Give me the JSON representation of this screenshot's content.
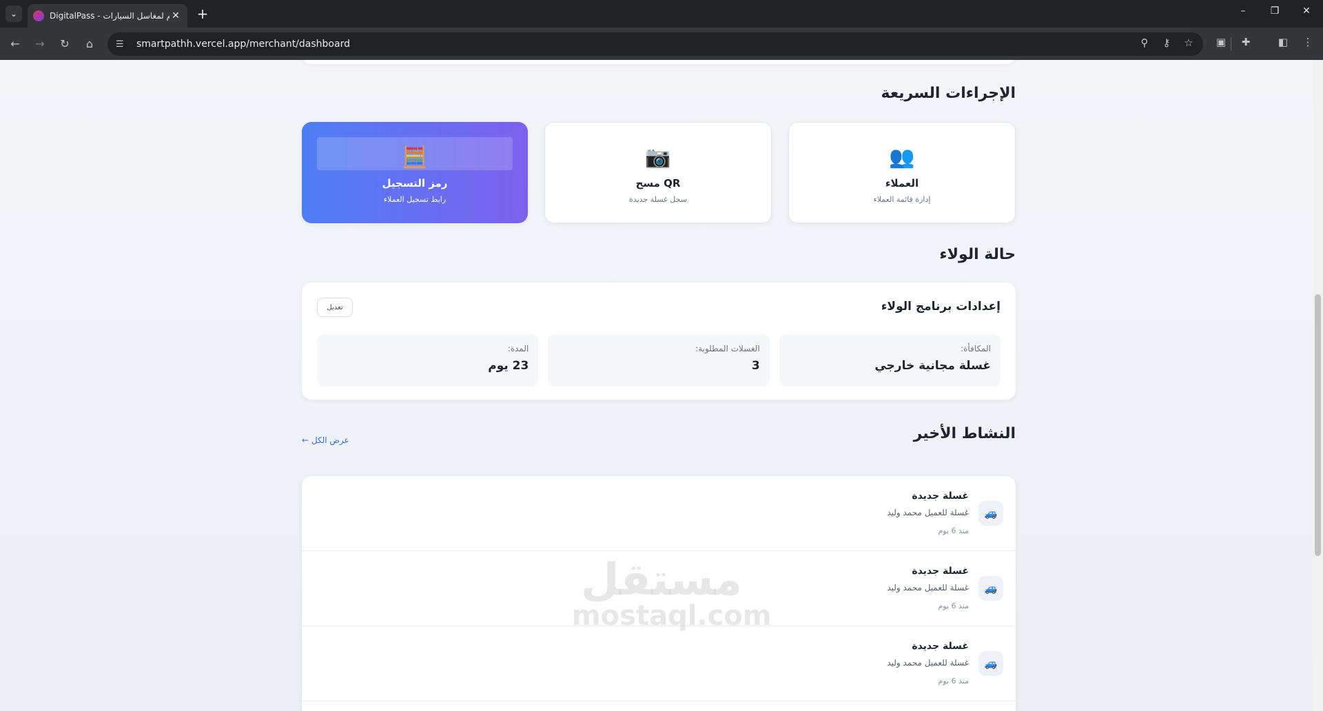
{
  "browser": {
    "tab_title": "DigitalPass - نظام لمغاسل السيارات",
    "url": "smartpathh.vercel.app/merchant/dashboard"
  },
  "quick_actions": {
    "title": "الإجراءات السريعة",
    "items": [
      {
        "icon": "users-icon",
        "glyph": "👥",
        "title": "العملاء",
        "subtitle": "إدارة قائمة العملاء"
      },
      {
        "icon": "camera-icon",
        "glyph": "📷",
        "title": "مسح QR",
        "subtitle": "سجل غسلة جديدة"
      },
      {
        "icon": "calculator-icon",
        "glyph": "🧮",
        "title": "رمز التسجيل",
        "subtitle": "رابط تسجيل العملاء"
      }
    ]
  },
  "loyalty": {
    "title": "حالة الولاء",
    "card_title": "إعدادات برنامج الولاء",
    "edit_label": "تعديل",
    "stats": [
      {
        "label": "المكافأة:",
        "value": "غسلة مجانية خارجي"
      },
      {
        "label": "الغسلات المطلوبة:",
        "value": "3"
      },
      {
        "label": "المدة:",
        "value": "23 يوم"
      }
    ]
  },
  "activity": {
    "title": "النشاط الأخير",
    "view_all": "عرض الكل ←",
    "items": [
      {
        "title": "غسلة جديدة",
        "description": "غسلة للعميل محمد وليد",
        "time": "منذ 6 يوم"
      },
      {
        "title": "غسلة جديدة",
        "description": "غسلة للعميل محمد وليد",
        "time": "منذ 6 يوم"
      },
      {
        "title": "غسلة جديدة",
        "description": "غسلة للعميل محمد وليد",
        "time": "منذ 6 يوم"
      }
    ]
  },
  "watermark": {
    "arabic": "مستقل",
    "latin": "mostaql.com"
  },
  "colors": {
    "primary_start": "#4e7ef5",
    "primary_end": "#7c61ec",
    "link": "#3a6ae8"
  }
}
